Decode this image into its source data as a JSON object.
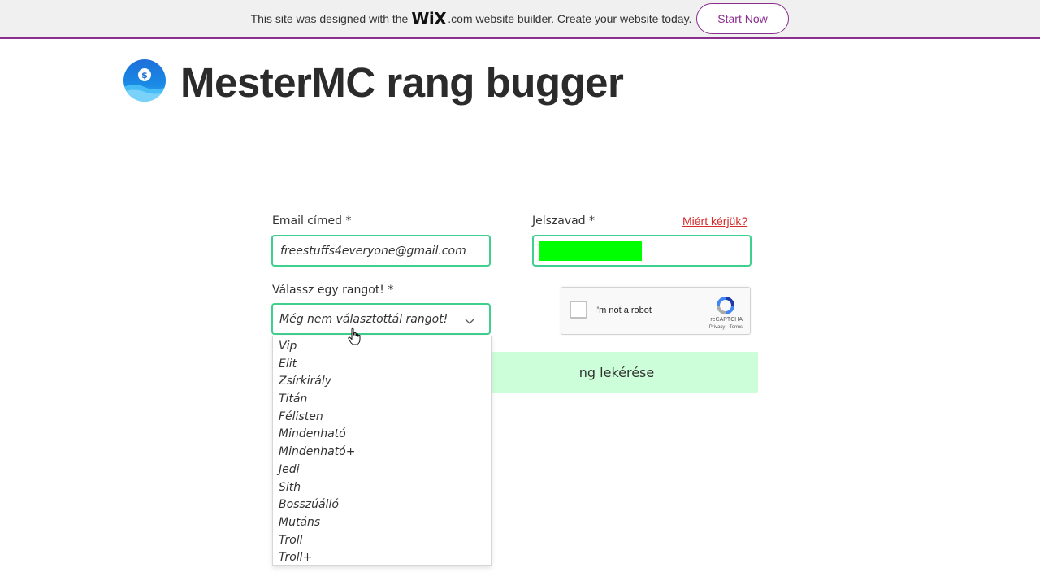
{
  "banner": {
    "prefix": "This site was designed with the",
    "wix": "WiX",
    "dotcom": ".com",
    "suffix": "website builder. Create your website today.",
    "button": "Start Now"
  },
  "header": {
    "title": "MesterMC rang bugger",
    "logo_icon": "dollar-coin-icon"
  },
  "form": {
    "email_label": "Email címed *",
    "email_value": "freestuffs4everyone@gmail.com",
    "password_label": "Jelszavad *",
    "why_link": "Miért kérjük?",
    "rank_label": "Válassz egy rangot! *",
    "rank_selected": "Még nem választottál rangot!",
    "rank_options": [
      "Vip",
      "Elit",
      "Zsírkirály",
      "Titán",
      "Félisten",
      "Mindenható",
      "Mindenható+",
      "Jedi",
      "Sith",
      "Bosszúálló",
      "Mutáns",
      "Troll",
      "Troll+"
    ],
    "submit_label": "Rang lekérése",
    "submit_visible_label": "ng lekérése"
  },
  "recaptcha": {
    "label": "I'm not a robot",
    "brand": "reCAPTCHA",
    "terms": "Privacy - Terms"
  },
  "colors": {
    "accent": "#8b2f8f",
    "field_border": "#3fcf8e",
    "password_mask": "#00ff00",
    "submit_bg": "#ccffd9",
    "link": "#d62b2b"
  }
}
